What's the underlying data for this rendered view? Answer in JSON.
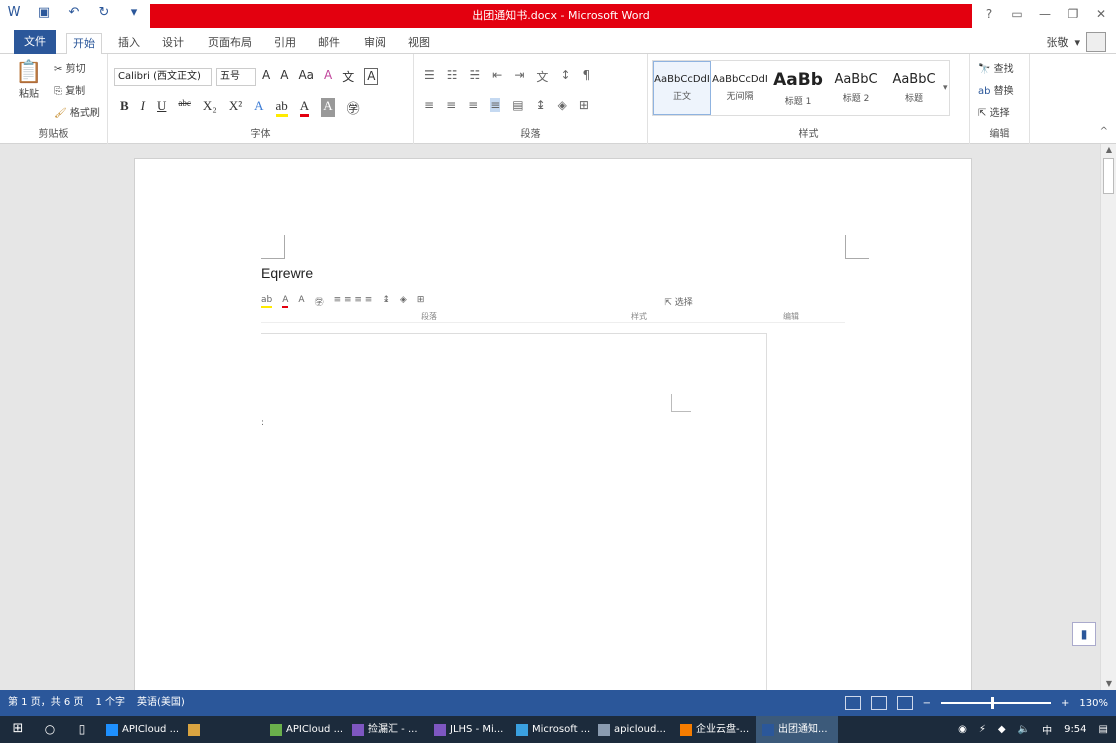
{
  "window": {
    "title": "出团通知书.docx - Microsoft Word",
    "accent": "#2b579a",
    "titlebar_color": "#e3000f"
  },
  "qat": [
    "save-icon",
    "undo-icon",
    "redo-icon",
    "customize-qat-icon"
  ],
  "tabs": {
    "file": "文件",
    "items": [
      "开始",
      "插入",
      "设计",
      "页面布局",
      "引用",
      "邮件",
      "审阅",
      "视图"
    ],
    "active": "开始"
  },
  "user": {
    "name": "张敬"
  },
  "clipboard": {
    "paste": "粘贴",
    "cut": "剪切",
    "copy": "复制",
    "format_painter": "格式刷",
    "label": "剪贴板"
  },
  "font": {
    "name": "Calibri (西文正文)",
    "size": "五号",
    "label": "字体"
  },
  "paragraph": {
    "label": "段落"
  },
  "styles": {
    "label": "样式",
    "items": [
      {
        "sample": "AaBbCcDdI",
        "name": "正文"
      },
      {
        "sample": "AaBbCcDdI",
        "name": "无间隔"
      },
      {
        "sample": "AaBb",
        "name": "标题 1"
      },
      {
        "sample": "AaBbC",
        "name": "标题 2"
      },
      {
        "sample": "AaBbC",
        "name": "标题"
      }
    ]
  },
  "editing": {
    "find": "查找",
    "replace": "替换",
    "select": "选择",
    "label": "编辑"
  },
  "document": {
    "text": "Eqrewre",
    "embedded": {
      "para_label": "段落",
      "style_label": "样式",
      "edit_label": "编辑",
      "select": "选择"
    }
  },
  "status": {
    "page": "第 1 页，共 6 页",
    "words": "1 个字",
    "language": "英语(美国)",
    "zoom": "130%"
  },
  "taskbar": {
    "apps": [
      "APICloud ...",
      "APICloud ...",
      "捡漏汇 - ...",
      "JLHS - Mi...",
      "Microsoft ...",
      "apicloud...",
      "企业云盘-...",
      "出团通知..."
    ],
    "time": "9:54",
    "ime": "中"
  }
}
